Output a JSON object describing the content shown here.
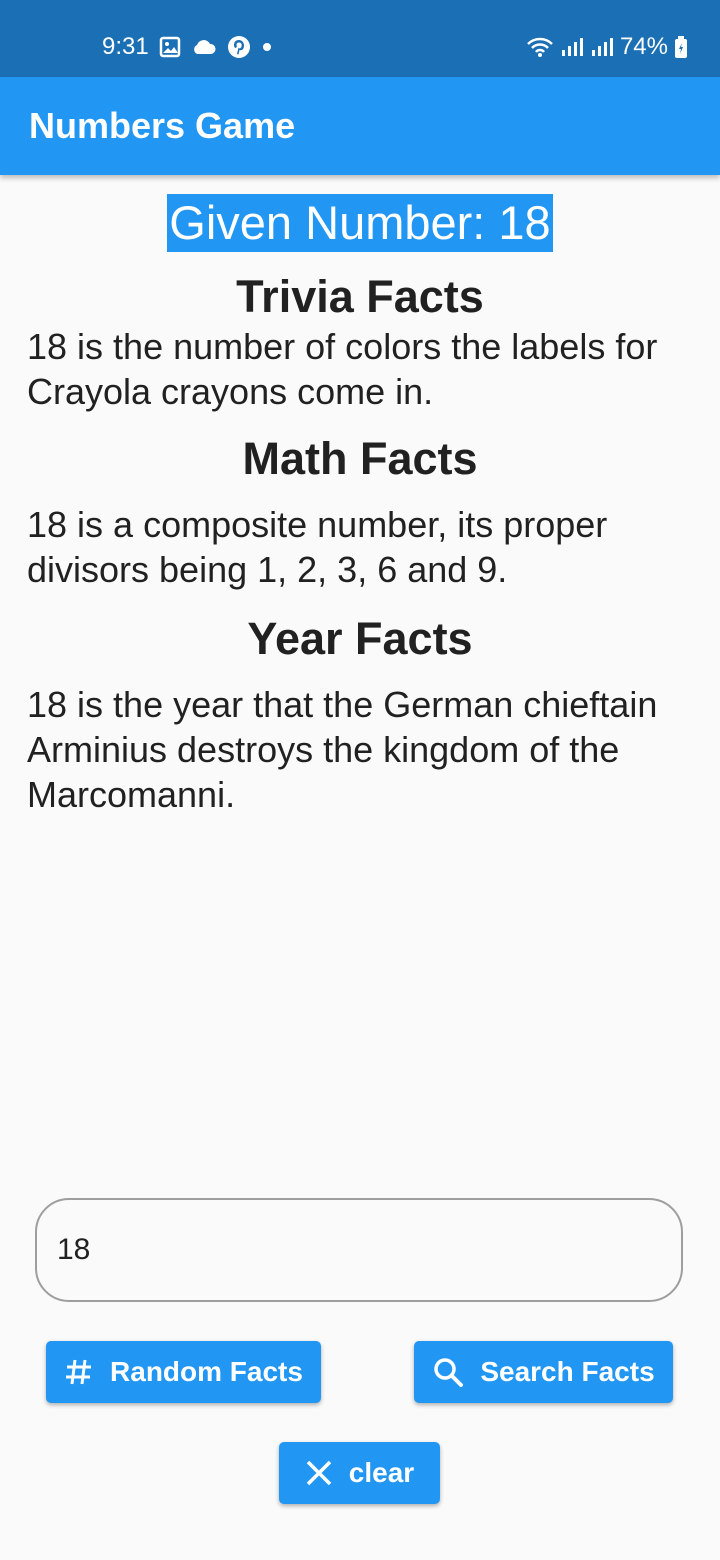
{
  "status_bar": {
    "time": "9:31",
    "battery": "74%",
    "icons": [
      "gallery-icon",
      "cloud-icon",
      "pinterest-icon",
      "dot-icon",
      "wifi-icon",
      "signal-icon",
      "signal-icon",
      "battery-icon"
    ]
  },
  "app_bar": {
    "title": "Numbers Game"
  },
  "main": {
    "given_number": "Given Number: 18",
    "trivia_heading": "Trivia Facts",
    "trivia_text": "18 is the number of colors the labels for Crayola crayons come in.",
    "math_heading": "Math Facts",
    "math_text": "18 is a composite number, its proper divisors being 1, 2, 3, 6 and 9.",
    "year_heading": "Year Facts",
    "year_text": "18 is the year that the German chieftain Arminius destroys the kingdom of the Marcomanni."
  },
  "input": {
    "value": "18"
  },
  "buttons": {
    "random_label": "Random Facts",
    "search_label": "Search Facts",
    "clear_label": "clear"
  },
  "colors": {
    "status_bar": "#1b6fb5",
    "primary": "#2196f3",
    "background": "#fafafa",
    "text": "#212121"
  }
}
